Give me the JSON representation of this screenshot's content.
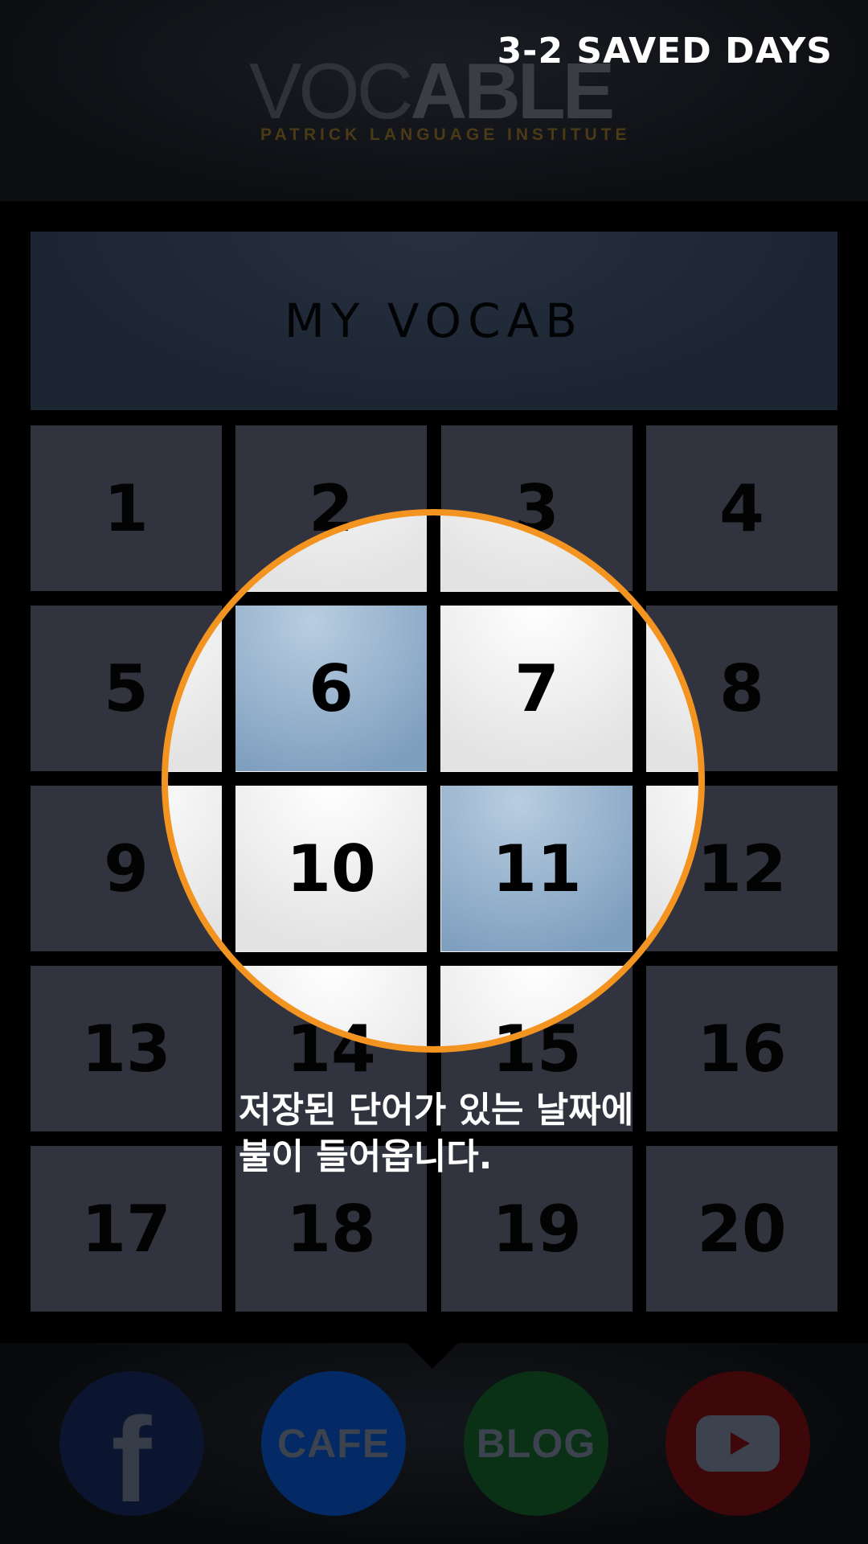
{
  "header": {
    "logo_light": "VOC",
    "logo_bold": "ABLE",
    "logo_subtitle": "PATRICK LANGUAGE INSTITUTE",
    "saved_days_label": "3-2 SAVED DAYS"
  },
  "vocab": {
    "title": "MY VOCAB",
    "days": [
      "1",
      "2",
      "3",
      "4",
      "5",
      "6",
      "7",
      "8",
      "9",
      "10",
      "11",
      "12",
      "13",
      "14",
      "15",
      "16",
      "17",
      "18",
      "19",
      "20"
    ],
    "saved_days": [
      "6",
      "11"
    ]
  },
  "spotlight": {
    "days_shown": [
      "2",
      "3",
      "5",
      "6",
      "7",
      "8",
      "9",
      "10",
      "11",
      "12",
      "14",
      "15"
    ],
    "accent_color": "#f39420",
    "saved_color": "#8fabc8"
  },
  "tooltip": {
    "line1": "저장된 단어가 있는 날짜에",
    "line2": "불이 들어옵니다."
  },
  "footer": {
    "facebook": {
      "icon": "facebook-icon",
      "label": "f",
      "color": "#0c1530"
    },
    "cafe": {
      "icon": "cafe-icon",
      "label": "CAFE",
      "color": "#032a64"
    },
    "blog": {
      "icon": "blog-icon",
      "label": "BLOG",
      "color": "#0a3016"
    },
    "youtube": {
      "icon": "youtube-icon",
      "color": "#3e080b"
    }
  }
}
